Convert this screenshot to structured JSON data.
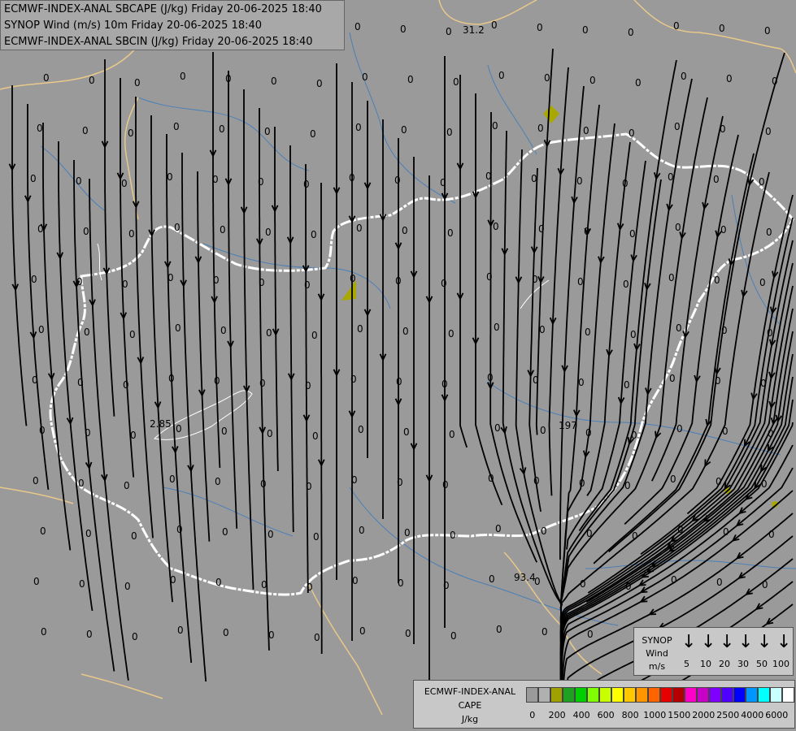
{
  "header": {
    "line1": "ECMWF-INDEX-ANAL SBCAPE (J/kg) Friday 20-06-2025 18:40",
    "line2": "SYNOP Wind (m/s) 10m Friday 20-06-2025 18:40",
    "line3": "ECMWF-INDEX-ANAL SBCIN (J/kg) Friday 20-06-2025 18:40"
  },
  "colors": {
    "background": "#9a9a9a",
    "streamline": "#000000",
    "border_national": "#ffffff",
    "border_outer": "#e8c98a",
    "rivers": "#4a7fb8",
    "cape_blob": "#a8a800"
  },
  "map_labels": {
    "cape_31_2": "31.2",
    "cape_2_85": "2.85",
    "cape_197": "197",
    "cape_93_4": "93.4",
    "zero": "0"
  },
  "wind_legend": {
    "title_1": "SYNOP",
    "title_2": "Wind",
    "unit": "m/s",
    "values": [
      "5",
      "10",
      "20",
      "30",
      "50",
      "100"
    ]
  },
  "cape_legend": {
    "title_1": "ECMWF-INDEX-ANAL",
    "title_2": "CAPE",
    "unit": "J/kg",
    "colors": [
      "#9a9a9a",
      "#b0b0b0",
      "#a0a000",
      "#20a020",
      "#00d000",
      "#80ff00",
      "#c8ff00",
      "#ffff00",
      "#ffc800",
      "#ff9600",
      "#ff6400",
      "#e60000",
      "#b40000",
      "#ff00c8",
      "#c800c8",
      "#8000ff",
      "#5000ff",
      "#0000ff",
      "#0096ff",
      "#00ffff",
      "#c8ffff",
      "#ffffff"
    ],
    "tick_labels": [
      "0",
      "200",
      "400",
      "600",
      "800",
      "1000",
      "1500",
      "2000",
      "2500",
      "4000",
      "6000"
    ]
  }
}
